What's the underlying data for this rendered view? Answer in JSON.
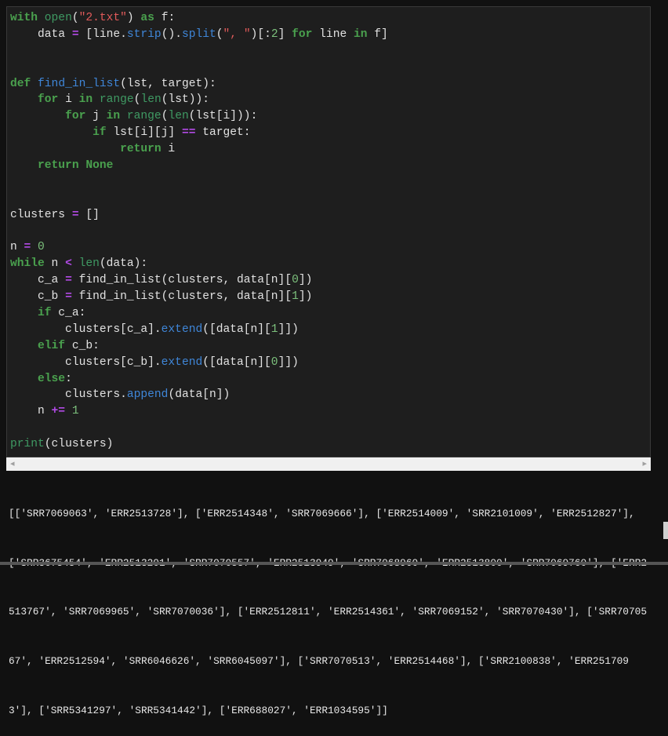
{
  "colors": {
    "background": "#1e1e1e",
    "keyword": "#4aa14e",
    "builtin": "#3f9a63",
    "function": "#3f86d8",
    "string": "#e05a5a",
    "operator": "#b24ae6",
    "number": "#7cc07c",
    "text": "#e2e2e2"
  },
  "code": [
    [
      [
        "kw",
        "with"
      ],
      [
        "tx",
        " "
      ],
      [
        "bi",
        "open"
      ],
      [
        "tx",
        "("
      ],
      [
        "str",
        "\"2.txt\""
      ],
      [
        "tx",
        ") "
      ],
      [
        "kw",
        "as"
      ],
      [
        "tx",
        " f:"
      ]
    ],
    [
      [
        "tx",
        "    data "
      ],
      [
        "op",
        "="
      ],
      [
        "tx",
        " [line."
      ],
      [
        "fn",
        "strip"
      ],
      [
        "tx",
        "()."
      ],
      [
        "fn",
        "split"
      ],
      [
        "tx",
        "("
      ],
      [
        "str",
        "\", \""
      ],
      [
        "tx",
        ")[:"
      ],
      [
        "num",
        "2"
      ],
      [
        "tx",
        "] "
      ],
      [
        "kw",
        "for"
      ],
      [
        "tx",
        " line "
      ],
      [
        "kw",
        "in"
      ],
      [
        "tx",
        " f]"
      ]
    ],
    [],
    [],
    [
      [
        "kw",
        "def"
      ],
      [
        "tx",
        " "
      ],
      [
        "fn",
        "find_in_list"
      ],
      [
        "tx",
        "(lst, target):"
      ]
    ],
    [
      [
        "tx",
        "    "
      ],
      [
        "kw",
        "for"
      ],
      [
        "tx",
        " i "
      ],
      [
        "kw",
        "in"
      ],
      [
        "tx",
        " "
      ],
      [
        "bi",
        "range"
      ],
      [
        "tx",
        "("
      ],
      [
        "bi",
        "len"
      ],
      [
        "tx",
        "(lst)):"
      ]
    ],
    [
      [
        "tx",
        "        "
      ],
      [
        "kw",
        "for"
      ],
      [
        "tx",
        " j "
      ],
      [
        "kw",
        "in"
      ],
      [
        "tx",
        " "
      ],
      [
        "bi",
        "range"
      ],
      [
        "tx",
        "("
      ],
      [
        "bi",
        "len"
      ],
      [
        "tx",
        "(lst[i])):"
      ]
    ],
    [
      [
        "tx",
        "            "
      ],
      [
        "kw",
        "if"
      ],
      [
        "tx",
        " lst[i][j] "
      ],
      [
        "op",
        "=="
      ],
      [
        "tx",
        " target:"
      ]
    ],
    [
      [
        "tx",
        "                "
      ],
      [
        "kw",
        "return"
      ],
      [
        "tx",
        " i"
      ]
    ],
    [
      [
        "tx",
        "    "
      ],
      [
        "kw",
        "return"
      ],
      [
        "tx",
        " "
      ],
      [
        "kw",
        "None"
      ]
    ],
    [],
    [],
    [
      [
        "tx",
        "clusters "
      ],
      [
        "op",
        "="
      ],
      [
        "tx",
        " []"
      ]
    ],
    [],
    [
      [
        "tx",
        "n "
      ],
      [
        "op",
        "="
      ],
      [
        "tx",
        " "
      ],
      [
        "num",
        "0"
      ]
    ],
    [
      [
        "kw",
        "while"
      ],
      [
        "tx",
        " n "
      ],
      [
        "op",
        "<"
      ],
      [
        "tx",
        " "
      ],
      [
        "bi",
        "len"
      ],
      [
        "tx",
        "(data):"
      ]
    ],
    [
      [
        "tx",
        "    c_a "
      ],
      [
        "op",
        "="
      ],
      [
        "tx",
        " find_in_list(clusters, data[n]["
      ],
      [
        "num",
        "0"
      ],
      [
        "tx",
        "])"
      ]
    ],
    [
      [
        "tx",
        "    c_b "
      ],
      [
        "op",
        "="
      ],
      [
        "tx",
        " find_in_list(clusters, data[n]["
      ],
      [
        "num",
        "1"
      ],
      [
        "tx",
        "])"
      ]
    ],
    [
      [
        "tx",
        "    "
      ],
      [
        "kw",
        "if"
      ],
      [
        "tx",
        " c_a:"
      ]
    ],
    [
      [
        "tx",
        "        clusters[c_a]."
      ],
      [
        "fn",
        "extend"
      ],
      [
        "tx",
        "([data[n]["
      ],
      [
        "num",
        "1"
      ],
      [
        "tx",
        "]])"
      ]
    ],
    [
      [
        "tx",
        "    "
      ],
      [
        "kw",
        "elif"
      ],
      [
        "tx",
        " c_b:"
      ]
    ],
    [
      [
        "tx",
        "        clusters[c_b]."
      ],
      [
        "fn",
        "extend"
      ],
      [
        "tx",
        "([data[n]["
      ],
      [
        "num",
        "0"
      ],
      [
        "tx",
        "]])"
      ]
    ],
    [
      [
        "tx",
        "    "
      ],
      [
        "kw",
        "else"
      ],
      [
        "tx",
        ":"
      ]
    ],
    [
      [
        "tx",
        "        clusters."
      ],
      [
        "fn",
        "append"
      ],
      [
        "tx",
        "(data[n])"
      ]
    ],
    [
      [
        "tx",
        "    n "
      ],
      [
        "op",
        "+="
      ],
      [
        "tx",
        " "
      ],
      [
        "num",
        "1"
      ]
    ],
    [],
    [
      [
        "bi",
        "print"
      ],
      [
        "tx",
        "(clusters)"
      ]
    ]
  ],
  "output": [
    "[['SRR7069063', 'ERR2513728'], ['ERR2514348', 'SRR7069666'], ['ERR2514009', 'SRR2101009', 'ERR2512827'],",
    "['SRR3675454', 'ERR2513201', 'SRR7070557', 'ERR2513949', 'SRR7068960', 'ERR2513800', 'SRR7069760'], ['ERR2",
    "513767', 'SRR7069965', 'SRR7070036'], ['ERR2512811', 'ERR2514361', 'SRR7069152', 'SRR7070430'], ['SRR70705",
    "67', 'ERR2512594', 'SRR6046626', 'SRR6045097'], ['SRR7070513', 'ERR2514468'], ['SRR2100838', 'ERR251709",
    "3'], ['SRR5341297', 'SRR5341442'], ['ERR688027', 'ERR1034595']]"
  ],
  "scrollbar": {
    "left_arrow": "◂",
    "right_arrow": "▸"
  }
}
